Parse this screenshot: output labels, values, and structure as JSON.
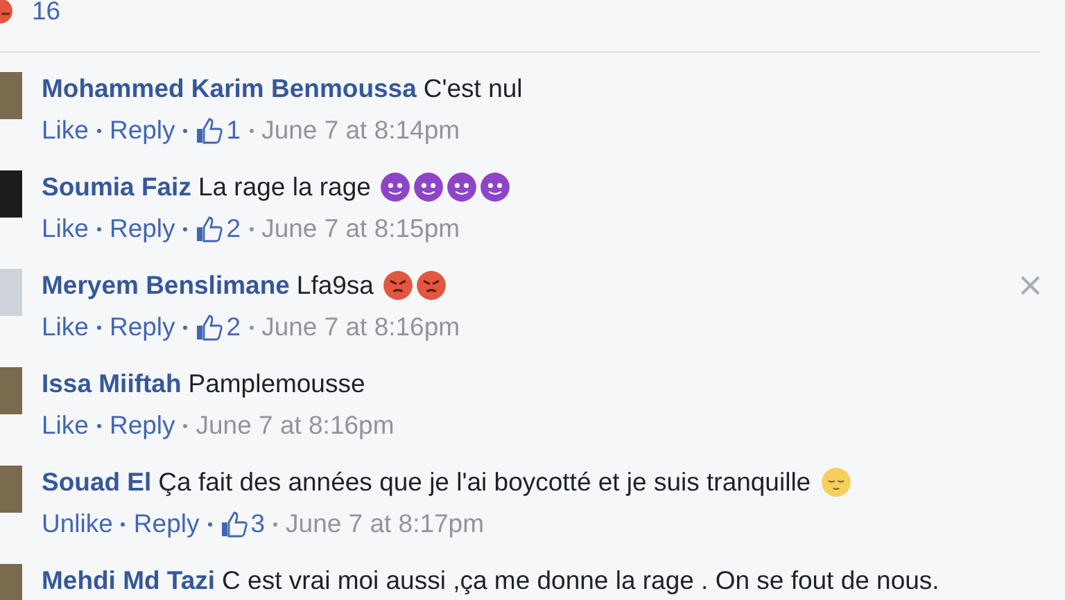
{
  "reactions": {
    "kind": "angry",
    "count": "16"
  },
  "comments": [
    {
      "author": "Mohammed Karim Benmoussa",
      "text": "C'est nul",
      "avatar": {
        "kind": "photo"
      },
      "closable": false,
      "actions": [
        "Like",
        "Reply"
      ],
      "likes": "1",
      "time": "June 7 at 8:14pm"
    },
    {
      "author": "Soumia Faiz",
      "text": "La rage la rage",
      "avatar": {
        "kind": "dark"
      },
      "emoji": [
        {
          "kind": "devil"
        },
        {
          "kind": "devil"
        },
        {
          "kind": "devil"
        },
        {
          "kind": "devil"
        }
      ],
      "closable": false,
      "actions": [
        "Like",
        "Reply"
      ],
      "likes": "2",
      "time": "June 7 at 8:15pm"
    },
    {
      "author": "Meryem Benslimane",
      "text": "Lfa9sa",
      "avatar": {
        "kind": "default"
      },
      "emoji": [
        {
          "kind": "angry"
        },
        {
          "kind": "angry"
        }
      ],
      "closable": true,
      "actions": [
        "Like",
        "Reply"
      ],
      "likes": "2",
      "time": "June 7 at 8:16pm"
    },
    {
      "author": "Issa Miiftah",
      "text": "Pamplemousse",
      "avatar": {
        "kind": "photo"
      },
      "closable": false,
      "actions": [
        "Like",
        "Reply"
      ],
      "time": "June 7 at 8:16pm"
    },
    {
      "author": "Souad El",
      "text": "Ça fait des années que je l'ai boycotté et je suis tranquille",
      "avatar": {
        "kind": "photo"
      },
      "emoji": [
        {
          "kind": "relieved"
        }
      ],
      "closable": false,
      "actions": [
        "Unlike",
        "Reply"
      ],
      "likes": "3",
      "time": "June 7 at 8:17pm"
    },
    {
      "author": "Mehdi Md Tazi",
      "text": "C est vrai moi aussi ,ça me donne la rage . On se fout de nous.",
      "avatar": {
        "kind": "photo"
      },
      "closable": false
    }
  ]
}
